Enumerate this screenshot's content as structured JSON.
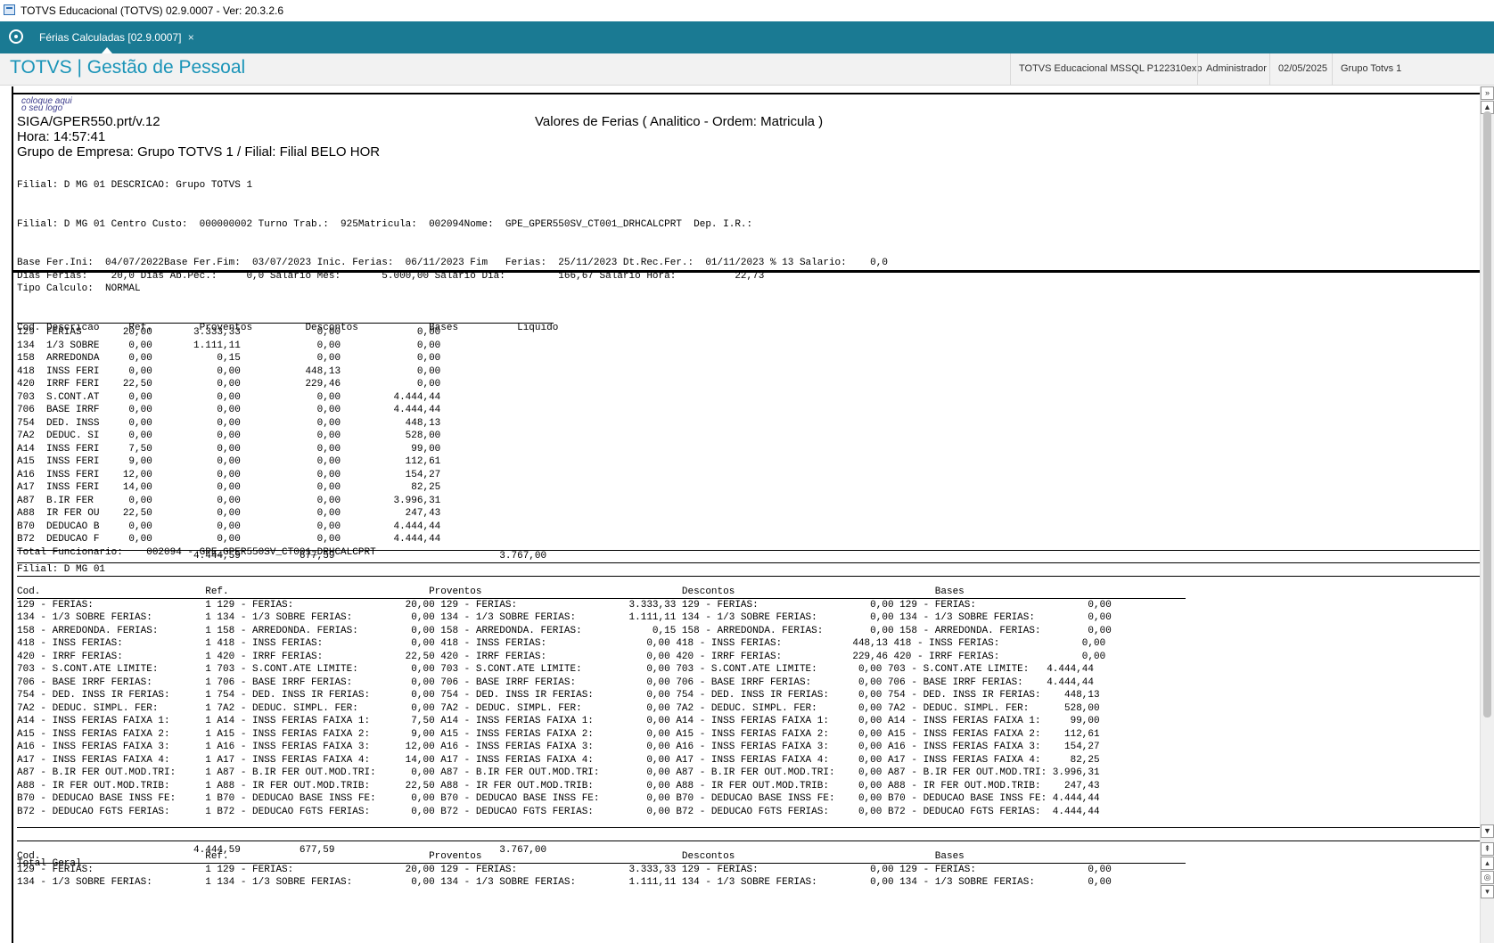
{
  "window": {
    "title": "TOTVS Educacional (TOTVS) 02.9.0007 - Ver: 20.3.2.6"
  },
  "tab": {
    "label": "Férias Calculadas [02.9.0007]",
    "close": "×"
  },
  "header": {
    "brand": "TOTVS | Gestão de Pessoal",
    "environment": "TOTVS Educacional MSSQL P122310exp",
    "user": "Administrador",
    "date": "02/05/2025",
    "group": "Grupo Totvs 1"
  },
  "report": {
    "logo_line1": "coloque aqui",
    "logo_line2": "o seu logo",
    "program": "SIGA/GPER550.prt/v.12",
    "time": "Hora: 14:57:41",
    "company": "Grupo de Empresa: Grupo TOTVS 1 / Filial: Filial BELO HOR",
    "title": "Valores de Ferias ( Analitico  - Ordem: Matricula )",
    "body1": "Filial: D MG 01 DESCRICAO: Grupo TOTVS 1\n\n\nFilial: D MG 01 Centro Custo:  000000002 Turno Trab.:  925Matricula:  002094Nome:  GPE_GPER550SV_CT001_DRHCALCPRT  Dep. I.R.:\n\n\nBase Fer.Ini:  04/07/2022Base Fer.Fim:  03/07/2023 Inic. Ferias:  06/11/2023 Fim   Ferias:  25/11/2023 Dt.Rec.Fer.:  01/11/2023 % 13 Salario:    0,0\nDias Ferias:    20,0 Dias Ab.Pec.:     0,0 Salario Mes:       5.000,00 Salario Dia:         166,67 Salario Hora:          22,73\nTipo Calculo:  NORMAL\n\n\nCod. Descricao     Ref.        Proventos         Descontos            Bases          Liquido",
    "body2": "129  FERIAS       20,00       3.333,33             0,00             0,00\n134  1/3 SOBRE     0,00       1.111,11             0,00             0,00\n158  ARREDONDA     0,00           0,15             0,00             0,00\n418  INSS FERI     0,00           0,00           448,13             0,00\n420  IRRF FERI    22,50           0,00           229,46             0,00\n703  S.CONT.AT     0,00           0,00             0,00         4.444,44\n706  BASE IRRF     0,00           0,00             0,00         4.444,44\n754  DED. INSS     0,00           0,00             0,00           448,13\n7A2  DEDUC. SI     0,00           0,00             0,00           528,00\nA14  INSS FERI     7,50           0,00             0,00            99,00\nA15  INSS FERI     9,00           0,00             0,00           112,61\nA16  INSS FERI    12,00           0,00             0,00           154,27\nA17  INSS FERI    14,00           0,00             0,00            82,25\nA87  B.IR FER      0,00           0,00             0,00         3.996,31\nA88  IR FER OU    22,50           0,00             0,00           247,43\nB70  DEDUCAO B     0,00           0,00             0,00         4.444,44\nB72  DEDUCAO F     0,00           0,00             0,00         4.444,44\nTotal Funcionario:    002094 - GPE_GPER550SV_CT001_DRHCALCPRT",
    "body3": "                              4.444,59          677,59                            3.767,00",
    "body4": "Filial: D MG 01",
    "body5": "Cod.                            Ref.                                  Proventos                                  Descontos                                  Bases\n129 - FERIAS:                   1 129 - FERIAS:                   20,00 129 - FERIAS:                   3.333,33 129 - FERIAS:                   0,00 129 - FERIAS:                   0,00\n134 - 1/3 SOBRE FERIAS:         1 134 - 1/3 SOBRE FERIAS:          0,00 134 - 1/3 SOBRE FERIAS:         1.111,11 134 - 1/3 SOBRE FERIAS:         0,00 134 - 1/3 SOBRE FERIAS:         0,00\n158 - ARREDONDA. FERIAS:        1 158 - ARREDONDA. FERIAS:         0,00 158 - ARREDONDA. FERIAS:            0,15 158 - ARREDONDA. FERIAS:        0,00 158 - ARREDONDA. FERIAS:        0,00\n418 - INSS FERIAS:              1 418 - INSS FERIAS:               0,00 418 - INSS FERIAS:                 0,00 418 - INSS FERIAS:            448,13 418 - INSS FERIAS:              0,00\n420 - IRRF FERIAS:              1 420 - IRRF FERIAS:              22,50 420 - IRRF FERIAS:                 0,00 420 - IRRF FERIAS:            229,46 420 - IRRF FERIAS:              0,00\n703 - S.CONT.ATE LIMITE:        1 703 - S.CONT.ATE LIMITE:         0,00 703 - S.CONT.ATE LIMITE:           0,00 703 - S.CONT.ATE LIMITE:       0,00 703 - S.CONT.ATE LIMITE:   4.444,44\n706 - BASE IRRF FERIAS:         1 706 - BASE IRRF FERIAS:          0,00 706 - BASE IRRF FERIAS:            0,00 706 - BASE IRRF FERIAS:        0,00 706 - BASE IRRF FERIAS:    4.444,44\n754 - DED. INSS IR FERIAS:      1 754 - DED. INSS IR FERIAS:       0,00 754 - DED. INSS IR FERIAS:         0,00 754 - DED. INSS IR FERIAS:     0,00 754 - DED. INSS IR FERIAS:    448,13\n7A2 - DEDUC. SIMPL. FER:        1 7A2 - DEDUC. SIMPL. FER:         0,00 7A2 - DEDUC. SIMPL. FER:           0,00 7A2 - DEDUC. SIMPL. FER:       0,00 7A2 - DEDUC. SIMPL. FER:      528,00\nA14 - INSS FERIAS FAIXA 1:      1 A14 - INSS FERIAS FAIXA 1:       7,50 A14 - INSS FERIAS FAIXA 1:         0,00 A14 - INSS FERIAS FAIXA 1:     0,00 A14 - INSS FERIAS FAIXA 1:     99,00\nA15 - INSS FERIAS FAIXA 2:      1 A15 - INSS FERIAS FAIXA 2:       9,00 A15 - INSS FERIAS FAIXA 2:         0,00 A15 - INSS FERIAS FAIXA 2:     0,00 A15 - INSS FERIAS FAIXA 2:    112,61\nA16 - INSS FERIAS FAIXA 3:      1 A16 - INSS FERIAS FAIXA 3:      12,00 A16 - INSS FERIAS FAIXA 3:         0,00 A16 - INSS FERIAS FAIXA 3:     0,00 A16 - INSS FERIAS FAIXA 3:    154,27\nA17 - INSS FERIAS FAIXA 4:      1 A17 - INSS FERIAS FAIXA 4:      14,00 A17 - INSS FERIAS FAIXA 4:         0,00 A17 - INSS FERIAS FAIXA 4:     0,00 A17 - INSS FERIAS FAIXA 4:     82,25\nA87 - B.IR FER OUT.MOD.TRI:     1 A87 - B.IR FER OUT.MOD.TRI:      0,00 A87 - B.IR FER OUT.MOD.TRI:        0,00 A87 - B.IR FER OUT.MOD.TRI:    0,00 A87 - B.IR FER OUT.MOD.TRI: 3.996,31\nA88 - IR FER OUT.MOD.TRIB:      1 A88 - IR FER OUT.MOD.TRIB:      22,50 A88 - IR FER OUT.MOD.TRIB:         0,00 A88 - IR FER OUT.MOD.TRIB:     0,00 A88 - IR FER OUT.MOD.TRIB:    247,43\nB70 - DEDUCAO BASE INSS FE:     1 B70 - DEDUCAO BASE INSS FE:      0,00 B70 - DEDUCAO BASE INSS FE:        0,00 B70 - DEDUCAO BASE INSS FE:    0,00 B70 - DEDUCAO BASE INSS FE: 4.444,44\nB72 - DEDUCAO FGTS FERIAS:      1 B72 - DEDUCAO FGTS FERIAS:       0,00 B72 - DEDUCAO FGTS FERIAS:         0,00 B72 - DEDUCAO FGTS FERIAS:     0,00 B72 - DEDUCAO FGTS FERIAS:  4.444,44\n\n\n                              4.444,59          677,59                            3.767,00\nTotal Geral",
    "body6": "Cod.                            Ref.                                  Proventos                                  Descontos                                  Bases\n129 - FERIAS:                   1 129 - FERIAS:                   20,00 129 - FERIAS:                   3.333,33 129 - FERIAS:                   0,00 129 - FERIAS:                   0,00\n134 - 1/3 SOBRE FERIAS:         1 134 - 1/3 SOBRE FERIAS:          0,00 134 - 1/3 SOBRE FERIAS:         1.111,11 134 - 1/3 SOBRE FERIAS:         0,00 134 - 1/3 SOBRE FERIAS:         0,00"
  },
  "scrollbar": {
    "up_icon": "arrow-up",
    "down_icon": "arrow-down"
  }
}
